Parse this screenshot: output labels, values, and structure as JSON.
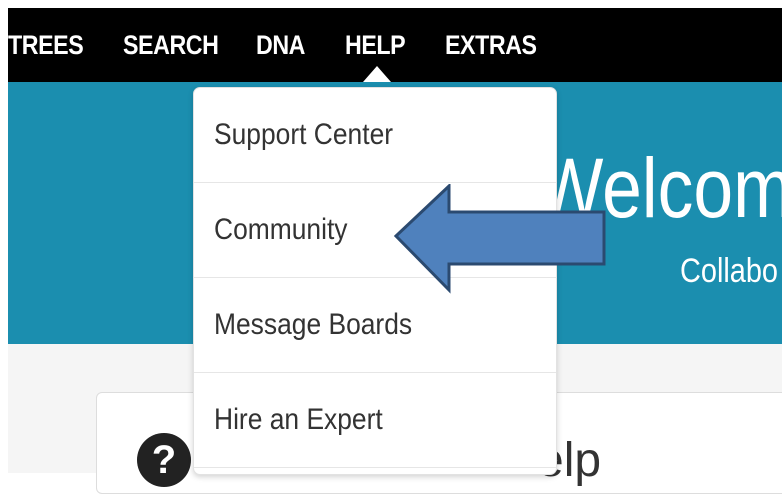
{
  "nav": {
    "items": [
      "TREES",
      "SEARCH",
      "DNA",
      "HELP",
      "EXTRAS"
    ],
    "active": "HELP"
  },
  "hero": {
    "title": "Welcom",
    "subtitle": "Collabo"
  },
  "help_menu": {
    "items": [
      "Support Center",
      "Community",
      "Message Boards",
      "Hire an Expert"
    ]
  },
  "card": {
    "icon_glyph": "?",
    "title_partial": "elp"
  },
  "colors": {
    "nav_bg": "#000000",
    "hero_bg": "#1b8eaf",
    "arrow_fill": "#4f81bd",
    "arrow_stroke": "#2b4a70"
  },
  "annotation": {
    "icon": "left-arrow-icon",
    "points_to": "Community"
  }
}
